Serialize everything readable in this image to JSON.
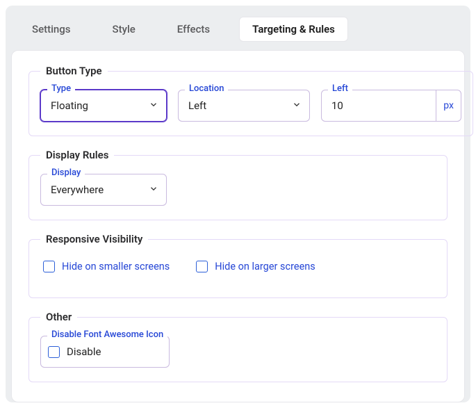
{
  "tabs": {
    "settings": "Settings",
    "style": "Style",
    "effects": "Effects",
    "targeting": "Targeting & Rules"
  },
  "groups": {
    "buttonType": {
      "legend": "Button Type",
      "type": {
        "label": "Type",
        "value": "Floating"
      },
      "location": {
        "label": "Location",
        "value": "Left"
      },
      "left": {
        "label": "Left",
        "value": "10",
        "unit": "px"
      }
    },
    "displayRules": {
      "legend": "Display Rules",
      "display": {
        "label": "Display",
        "value": "Everywhere"
      }
    },
    "responsive": {
      "legend": "Responsive Visibility",
      "hideSmaller": "Hide on smaller screens",
      "hideLarger": "Hide on larger screens"
    },
    "other": {
      "legend": "Other",
      "disableFa": {
        "label": "Disable Font Awesome Icon",
        "checkLabel": "Disable"
      }
    }
  }
}
